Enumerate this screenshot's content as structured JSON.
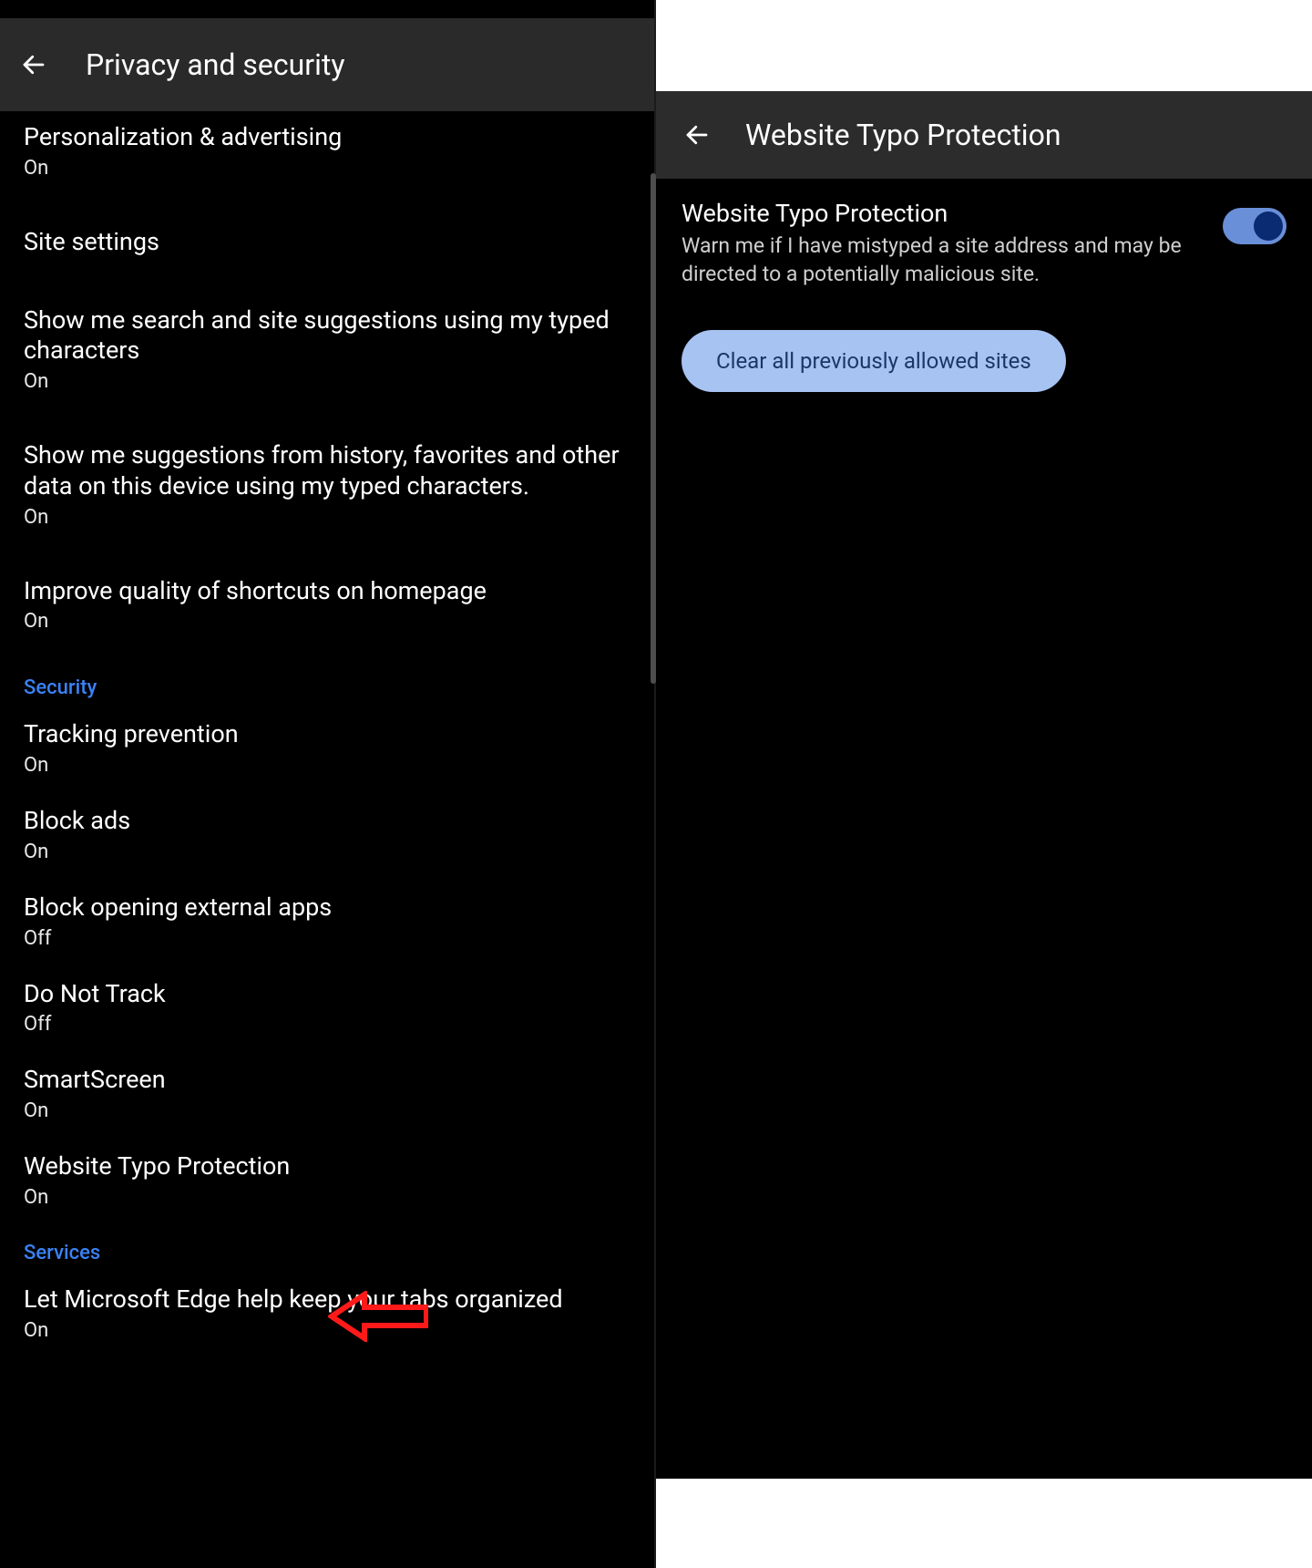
{
  "left": {
    "header_title": "Privacy and security",
    "items": [
      {
        "title": "Personalization & advertising",
        "sub": "On",
        "clipped": true
      },
      {
        "title": "Site settings",
        "sub": null
      },
      {
        "title": "Show me search and site suggestions using my typed characters",
        "sub": "On"
      },
      {
        "title": "Show me suggestions from history, favorites and other data on this device using my typed characters.",
        "sub": "On"
      },
      {
        "title": "Improve quality of shortcuts on homepage",
        "sub": "On"
      }
    ],
    "section_security": "Security",
    "security_items": [
      {
        "title": "Tracking prevention",
        "sub": "On"
      },
      {
        "title": "Block ads",
        "sub": "On"
      },
      {
        "title": "Block opening external apps",
        "sub": "Off"
      },
      {
        "title": "Do Not Track",
        "sub": "Off"
      },
      {
        "title": "SmartScreen",
        "sub": "On"
      },
      {
        "title": "Website Typo Protection",
        "sub": "On"
      }
    ],
    "section_services": "Services",
    "services_items": [
      {
        "title": "Let Microsoft Edge help keep your tabs organized",
        "sub": "On"
      }
    ]
  },
  "right": {
    "header_title": "Website Typo Protection",
    "toggle_title": "Website Typo Protection",
    "toggle_desc": "Warn me if I have mistyped a site address and may be directed to a potentially malicious site.",
    "toggle_on": true,
    "clear_button": "Clear all previously allowed sites"
  }
}
